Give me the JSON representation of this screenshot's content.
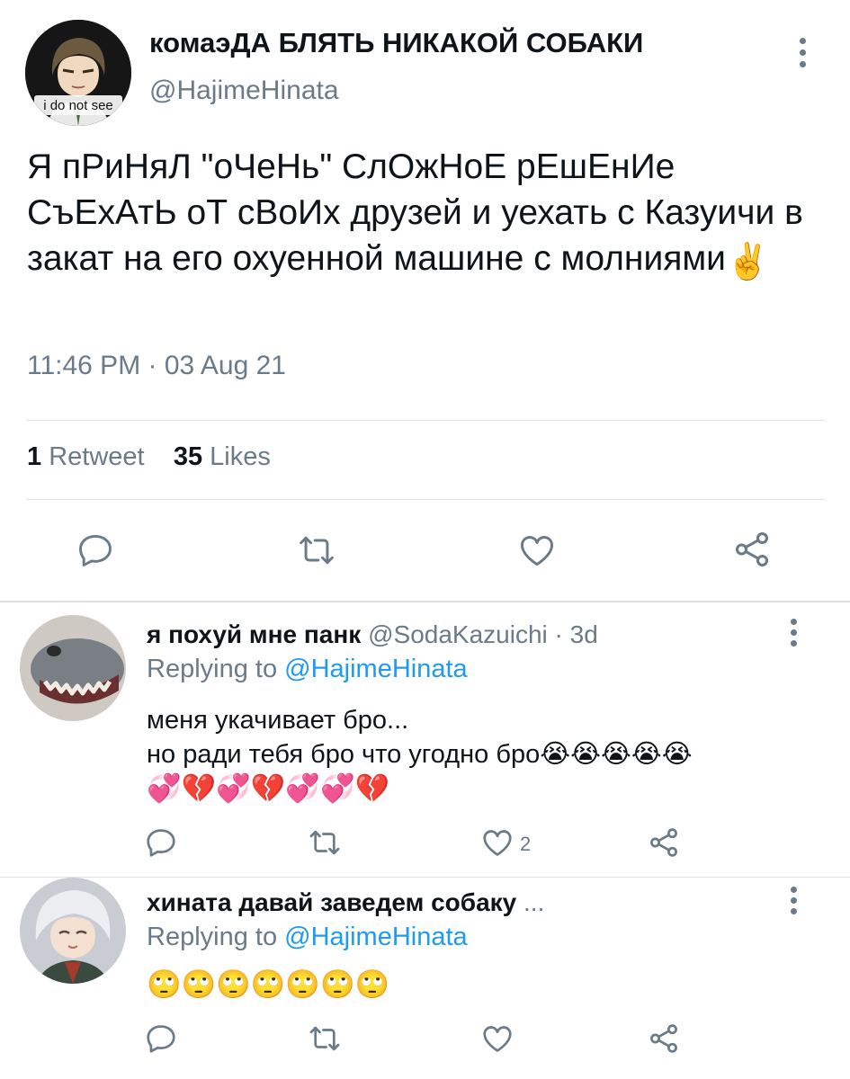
{
  "main_tweet": {
    "display_name": "комаэДА БЛЯТЬ НИКАКОЙ СОБАКИ",
    "handle": "@HajimeHinata",
    "avatar_caption": "i do not see",
    "text": "Я пРиНяЛ \"оЧеНь\" СлОжНоЕ рЕшЕнИе СъЕхАтЬ оТ сВоИх друзей и уехать с Казуичи в закат на его охуенной машине с молниями",
    "emoji": "✌️",
    "timestamp": "11:46 PM · 03 Aug 21",
    "retweets_count": "1",
    "retweets_label": "Retweet",
    "likes_count": "35",
    "likes_label": "Likes"
  },
  "replies": [
    {
      "display_name": "я похуй мне панк",
      "handle": "@SodaKazuichi",
      "age": "· 3d",
      "replying_prefix": "Replying to",
      "replying_to": "@HajimeHinata",
      "line1": "меня укачивает бро...",
      "line2": "но ради тебя бро что угодно бро😭😭😭😭😭",
      "line3": "💞💔💞💔💞💞💔",
      "like_count": "2"
    },
    {
      "display_name": "хината давай заведем собаку",
      "ellipsis": "...",
      "replying_prefix": "Replying to",
      "replying_to": "@HajimeHinata",
      "line1": "🙄🙄🙄🙄🙄🙄🙄"
    }
  ],
  "icons": [
    "reply-icon",
    "retweet-icon",
    "like-icon",
    "share-icon",
    "more-vertical-icon"
  ],
  "colors": {
    "text": "#0f1419",
    "secondary": "#6b7a88",
    "link": "#1d9bf0",
    "divider": "#dbe1e6"
  }
}
